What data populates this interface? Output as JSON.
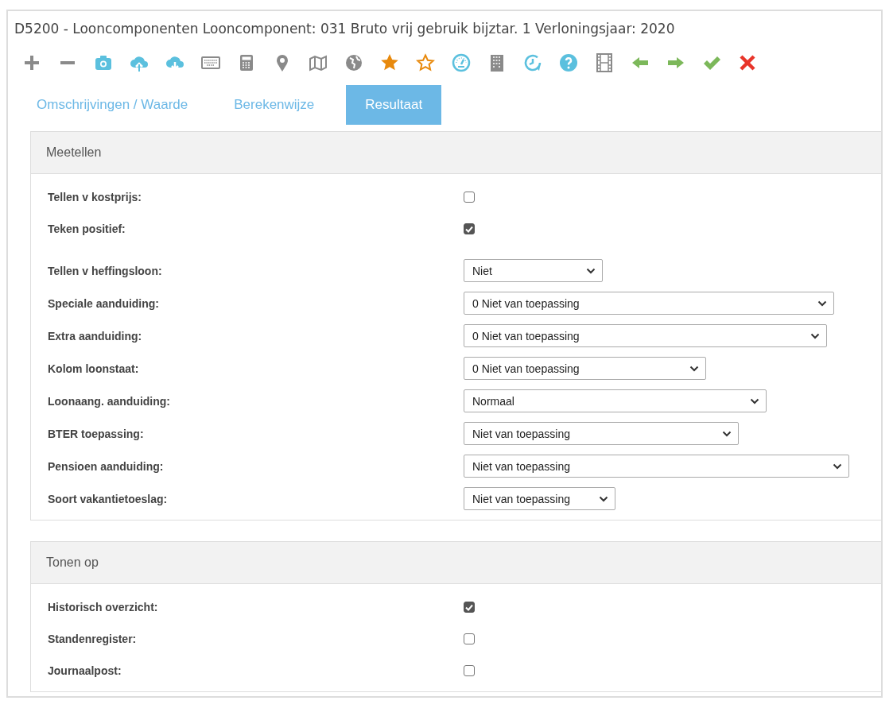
{
  "window": {
    "title": "D5200 - Looncomponenten Looncomponent: 031 Bruto vrij gebruik bijztar. 1 Verloningsjaar: 2020"
  },
  "tabs": [
    {
      "label": "Omschrijvingen / Waarde",
      "selected": false
    },
    {
      "label": "Berekenwijze",
      "selected": false
    },
    {
      "label": "Resultaat",
      "selected": true
    }
  ],
  "sections": [
    {
      "title": "Meetellen",
      "fields": [
        {
          "kind": "checkbox",
          "label": "Tellen v kostprijs:",
          "checked": false
        },
        {
          "kind": "checkbox",
          "label": "Teken positief:",
          "checked": true
        },
        {
          "kind": "select",
          "label": "Tellen v heffingsloon:",
          "value": "Niet"
        },
        {
          "kind": "select",
          "label": "Speciale aanduiding:",
          "value": "0 Niet van toepassing"
        },
        {
          "kind": "select",
          "label": "Extra aanduiding:",
          "value": "0 Niet van toepassing"
        },
        {
          "kind": "select",
          "label": "Kolom loonstaat:",
          "value": "0 Niet van toepassing"
        },
        {
          "kind": "select",
          "label": "Loonaang. aanduiding:",
          "value": "Normaal"
        },
        {
          "kind": "select",
          "label": "BTER toepassing:",
          "value": "Niet van toepassing"
        },
        {
          "kind": "select",
          "label": "Pensioen aanduiding:",
          "value": "Niet van toepassing"
        },
        {
          "kind": "select",
          "label": "Soort vakantietoeslag:",
          "value": "Niet van toepassing"
        }
      ]
    },
    {
      "title": "Tonen op",
      "fields": [
        {
          "kind": "checkbox",
          "label": "Historisch overzicht:",
          "checked": true
        },
        {
          "kind": "checkbox",
          "label": "Standenregister:",
          "checked": false
        },
        {
          "kind": "checkbox",
          "label": "Journaalpost:",
          "checked": false
        }
      ]
    }
  ]
}
